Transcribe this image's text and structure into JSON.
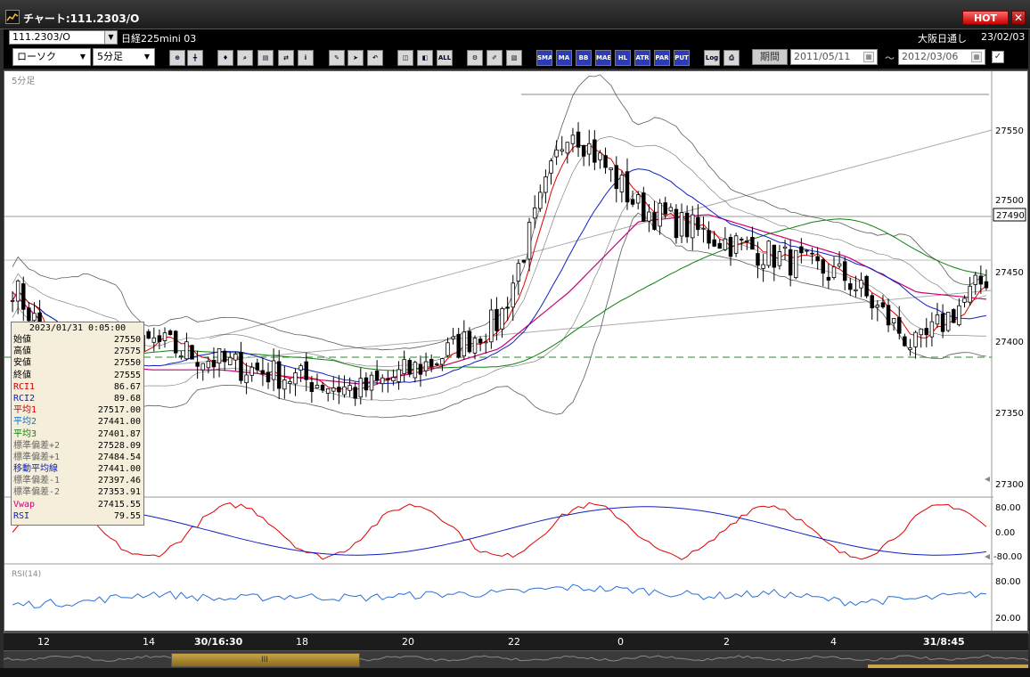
{
  "window": {
    "title": "チャート:111.2303/O",
    "hot_label": "HOT",
    "close_glyph": "✕"
  },
  "info_row": {
    "symbol": "111.2303/O",
    "product_name": "日経225mini 03",
    "market": "大阪日通し",
    "date": "23/02/03"
  },
  "toolbar": {
    "chart_type": "ローソク",
    "interval": "5分足",
    "icons": [
      "zoom-icon",
      "crosshair-icon",
      "marker-icon",
      "table-icon",
      "pen-icon",
      "eraser-icon",
      "trendline-icon",
      "cursor-icon",
      "undo-icon",
      "candle-icon",
      "bar-icon",
      "ALL",
      "settings-icon",
      "paint-icon",
      "color-icon",
      "SMA",
      "MA",
      "BB",
      "MAE",
      "HL",
      "ATR",
      "PAR",
      "PUT",
      "Log",
      "print-icon"
    ],
    "icon_labels": {
      "all": "ALL",
      "sma": "SMA",
      "ma": "MA",
      "bb": "BB",
      "mae": "MAE",
      "hl": "HL",
      "atr": "ATR",
      "par": "PAR",
      "put": "PUT",
      "log": "Log"
    },
    "period_label": "期間",
    "date_from": "2011/05/11",
    "date_to": "2012/03/06",
    "tilde": "〜",
    "check_glyph": "✓"
  },
  "chart": {
    "panel_label": "5分足",
    "price_labels": [
      "27550",
      "27500",
      "27450",
      "27400",
      "27350",
      "27300"
    ],
    "current_price": "27490",
    "osc_labels": [
      "80.00",
      "0.00",
      "-80.00"
    ],
    "rsi_title": "RSI(14)",
    "rsi_labels": [
      "80.00",
      "20.00"
    ],
    "x_labels": [
      "12",
      "14",
      "30/16:30",
      "18",
      "20",
      "22",
      "0",
      "2",
      "4",
      "31/8:45"
    ],
    "colors": {
      "candle_up": "#ffffff",
      "candle_down": "#000000",
      "ma1": "#e00000",
      "ma2": "#1020c0",
      "ma3": "#108010",
      "bb_mid": "#cc0077",
      "bands": "#333333",
      "rsi": "#2a6fd6",
      "rci1": "#e00000",
      "rci2": "#1020c0",
      "dashed": "#2a8a2a"
    }
  },
  "info_panel": {
    "datetime": "2023/01/31 0:05:00",
    "rows": [
      {
        "label": "始値",
        "value": "27550",
        "color": "#000000"
      },
      {
        "label": "高値",
        "value": "27575",
        "color": "#000000"
      },
      {
        "label": "安値",
        "value": "27550",
        "color": "#000000"
      },
      {
        "label": "終値",
        "value": "27555",
        "color": "#000000"
      },
      {
        "label": "RCI1",
        "value": "86.67",
        "color": "#d00000"
      },
      {
        "label": "RCI2",
        "value": "89.68",
        "color": "#1020c0"
      },
      {
        "label": "平均1",
        "value": "27517.00",
        "color": "#d00000"
      },
      {
        "label": "平均2",
        "value": "27441.00",
        "color": "#1070c0"
      },
      {
        "label": "平均3",
        "value": "27401.87",
        "color": "#108010"
      },
      {
        "label": "標準偏差+2",
        "value": "27528.09",
        "color": "#666666"
      },
      {
        "label": "標準偏差+1",
        "value": "27484.54",
        "color": "#666666"
      },
      {
        "label": "移動平均線",
        "value": "27441.00",
        "color": "#1020c0"
      },
      {
        "label": "標準偏差-1",
        "value": "27397.46",
        "color": "#666666"
      },
      {
        "label": "標準偏差-2",
        "value": "27353.91",
        "color": "#666666"
      },
      {
        "label": "Vwap",
        "value": "27415.55",
        "color": "#cc0077"
      },
      {
        "label": "RSI",
        "value": "79.55",
        "color": "#1020c0"
      }
    ]
  },
  "chart_data": {
    "type": "line",
    "x_labels": [
      "12",
      "14",
      "30/16:30",
      "18",
      "20",
      "22",
      "0",
      "2",
      "4",
      "31/8:45"
    ],
    "y_range": [
      27300,
      27580
    ],
    "current_price": 27490,
    "series": [
      {
        "values": [
          27445,
          27365,
          27405,
          27390,
          27380,
          27370,
          27390,
          27420,
          27560,
          27500,
          27480,
          27465,
          27450,
          27400,
          27450
        ]
      },
      {
        "values": [
          27440,
          27390,
          27385,
          27385,
          27380,
          27375,
          27385,
          27400,
          27440,
          27490,
          27495,
          27480,
          27465,
          27440,
          27435
        ]
      }
    ],
    "rsi": [
      40,
      45,
      60,
      50,
      55,
      52,
      58,
      60,
      70,
      65,
      55,
      60,
      45,
      50,
      60
    ]
  }
}
